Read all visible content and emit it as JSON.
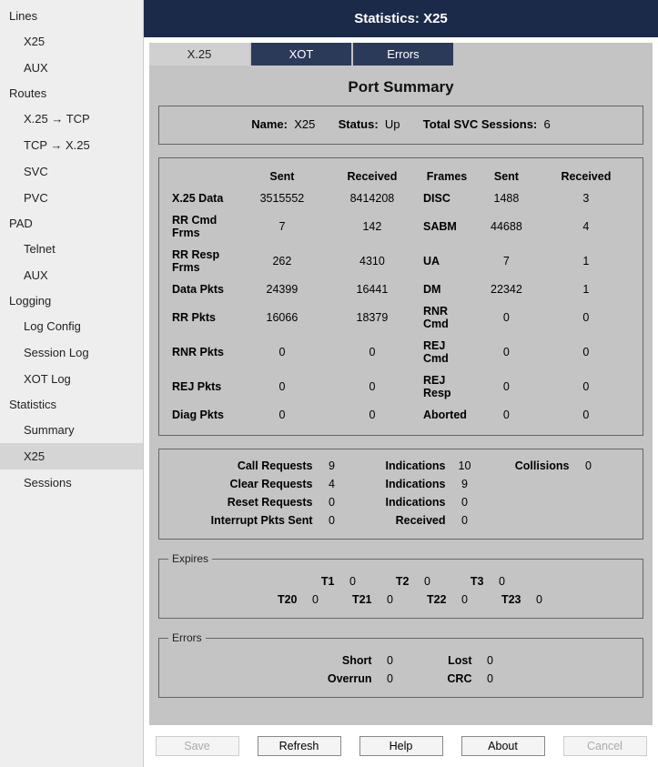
{
  "title": "Statistics: X25",
  "sidebar": {
    "groups": [
      {
        "label": "Lines",
        "items": [
          "X25",
          "AUX"
        ]
      },
      {
        "label": "Routes",
        "items": [
          "X.25 → TCP",
          "TCP → X.25",
          "SVC",
          "PVC"
        ]
      },
      {
        "label": "PAD",
        "items": [
          "Telnet",
          "AUX"
        ]
      },
      {
        "label": "Logging",
        "items": [
          "Log Config",
          "Session Log",
          "XOT Log"
        ]
      },
      {
        "label": "Statistics",
        "items": [
          "Summary",
          "X25",
          "Sessions"
        ]
      }
    ],
    "active": "X25"
  },
  "tabs": {
    "items": [
      "X.25",
      "XOT",
      "Errors"
    ],
    "active": "X.25"
  },
  "page_heading": "Port Summary",
  "summary": {
    "name_label": "Name:",
    "name": "X25",
    "status_label": "Status:",
    "status": "Up",
    "sessions_label": "Total SVC Sessions:",
    "sessions": "6"
  },
  "stat_headers": {
    "sent": "Sent",
    "received": "Received",
    "frames": "Frames"
  },
  "stat_rows": [
    {
      "label": "X.25 Data",
      "sent": "3515552",
      "received": "8414208",
      "frame": "DISC",
      "fsent": "1488",
      "frecv": "3"
    },
    {
      "label": "RR Cmd Frms",
      "sent": "7",
      "received": "142",
      "frame": "SABM",
      "fsent": "44688",
      "frecv": "4"
    },
    {
      "label": "RR Resp Frms",
      "sent": "262",
      "received": "4310",
      "frame": "UA",
      "fsent": "7",
      "frecv": "1"
    },
    {
      "label": "Data Pkts",
      "sent": "24399",
      "received": "16441",
      "frame": "DM",
      "fsent": "22342",
      "frecv": "1"
    },
    {
      "label": "RR Pkts",
      "sent": "16066",
      "received": "18379",
      "frame": "RNR Cmd",
      "fsent": "0",
      "frecv": "0"
    },
    {
      "label": "RNR Pkts",
      "sent": "0",
      "received": "0",
      "frame": "REJ Cmd",
      "fsent": "0",
      "frecv": "0"
    },
    {
      "label": "REJ Pkts",
      "sent": "0",
      "received": "0",
      "frame": "REJ Resp",
      "fsent": "0",
      "frecv": "0"
    },
    {
      "label": "Diag Pkts",
      "sent": "0",
      "received": "0",
      "frame": "Aborted",
      "fsent": "0",
      "frecv": "0"
    }
  ],
  "calls": {
    "rows": [
      {
        "l1": "Call Requests",
        "v1": "9",
        "l2": "Indications",
        "v2": "10",
        "l3": "Collisions",
        "v3": "0"
      },
      {
        "l1": "Clear Requests",
        "v1": "4",
        "l2": "Indications",
        "v2": "9",
        "l3": "",
        "v3": ""
      },
      {
        "l1": "Reset Requests",
        "v1": "0",
        "l2": "Indications",
        "v2": "0",
        "l3": "",
        "v3": ""
      },
      {
        "l1": "Interrupt Pkts Sent",
        "v1": "0",
        "l2": "Received",
        "v2": "0",
        "l3": "",
        "v3": ""
      }
    ]
  },
  "expires": {
    "legend": "Expires",
    "row1": [
      {
        "l": "T1",
        "v": "0"
      },
      {
        "l": "T2",
        "v": "0"
      },
      {
        "l": "T3",
        "v": "0"
      }
    ],
    "row2": [
      {
        "l": "T20",
        "v": "0"
      },
      {
        "l": "T21",
        "v": "0"
      },
      {
        "l": "T22",
        "v": "0"
      },
      {
        "l": "T23",
        "v": "0"
      }
    ]
  },
  "errors": {
    "legend": "Errors",
    "row1": [
      {
        "l": "Short",
        "v": "0"
      },
      {
        "l": "Lost",
        "v": "0"
      }
    ],
    "row2": [
      {
        "l": "Overrun",
        "v": "0"
      },
      {
        "l": "CRC",
        "v": "0"
      }
    ]
  },
  "buttons": {
    "save": "Save",
    "refresh": "Refresh",
    "help": "Help",
    "about": "About",
    "cancel": "Cancel"
  }
}
